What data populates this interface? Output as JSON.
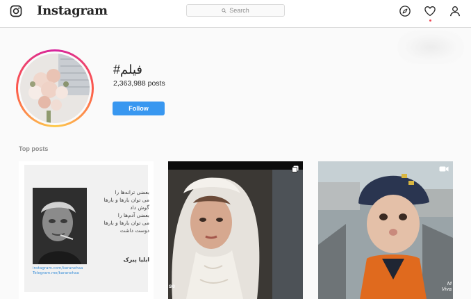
{
  "header": {
    "wordmark": "Instagram",
    "search_placeholder": "Search",
    "icons": [
      "instagram-logo-icon",
      "compass-icon",
      "heart-icon",
      "profile-icon"
    ],
    "notification_color": "#ed4956"
  },
  "tag": {
    "title": "#فیلم",
    "posts_count": "2,363,988 posts",
    "follow_label": "Follow",
    "follow_color": "#3897f0"
  },
  "top_posts": {
    "label": "Top posts",
    "items": [
      {
        "type": "image",
        "poem_lines": [
          "بعضی ترانه‌ها را",
          "می توان بارها و بارها",
          "گوش داد",
          "بعضی آدم‌ها را",
          "می توان بارها و بارها",
          "دوست داشت"
        ],
        "signature": "ایلیا پیرک",
        "links": [
          "instagram.com/karanehaa",
          "Telegram.me/karanehaa"
        ]
      },
      {
        "type": "gallery",
        "overlay_text": "se"
      },
      {
        "type": "video",
        "overlay_text": [
          "M",
          "Viva"
        ]
      }
    ]
  }
}
